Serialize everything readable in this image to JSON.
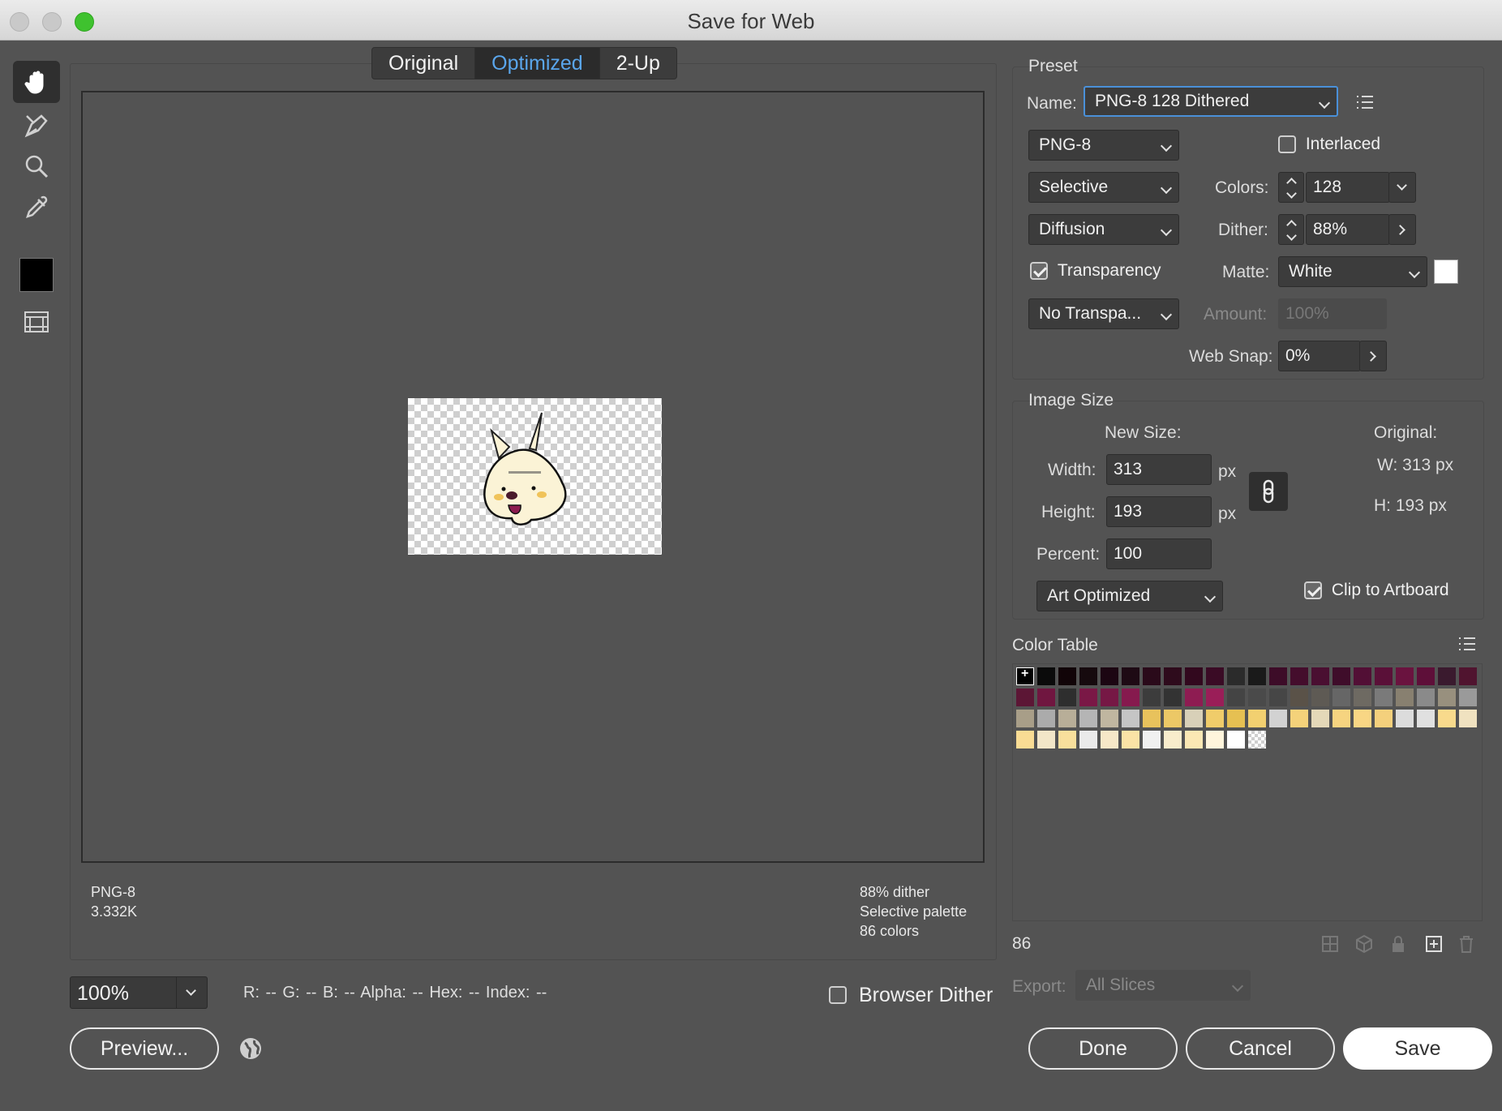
{
  "window": {
    "title": "Save for Web"
  },
  "tabs": [
    {
      "label": "Original",
      "active": false
    },
    {
      "label": "Optimized",
      "active": true
    },
    {
      "label": "2-Up",
      "active": false
    }
  ],
  "tools": [
    "hand-icon",
    "slice-select-icon",
    "zoom-icon",
    "eyedropper-icon",
    "eyedropper-color-swatch",
    "toggle-slices-icon"
  ],
  "preview_info": {
    "format": "PNG-8",
    "size": "3.332K",
    "dither": "88% dither",
    "palette": "Selective palette",
    "colors": "86 colors"
  },
  "bottom": {
    "zoom": "100%",
    "readout": "R: --  G: --  B: --  Alpha: --  Hex: --  Index: --",
    "browser_dither_label": "Browser Dither",
    "browser_dither_checked": false,
    "preview_button": "Preview...",
    "done_button": "Done",
    "cancel_button": "Cancel",
    "save_button": "Save"
  },
  "preset": {
    "group_label": "Preset",
    "name_label": "Name:",
    "name_value": "PNG-8 128 Dithered",
    "format": "PNG-8",
    "interlaced_label": "Interlaced",
    "interlaced_checked": false,
    "reduction": "Selective",
    "colors_label": "Colors:",
    "colors_value": "128",
    "dither_algo": "Diffusion",
    "dither_label": "Dither:",
    "dither_value": "88%",
    "transparency_label": "Transparency",
    "transparency_checked": true,
    "matte_label": "Matte:",
    "matte_value": "White",
    "matte_color": "#ffffff",
    "transparency_dither": "No Transpa...",
    "amount_label": "Amount:",
    "amount_value": "100%",
    "websnap_label": "Web Snap:",
    "websnap_value": "0%"
  },
  "image_size": {
    "group_label": "Image Size",
    "new_size_label": "New Size:",
    "original_label": "Original:",
    "width_label": "Width:",
    "width_value": "313",
    "height_label": "Height:",
    "height_value": "193",
    "percent_label": "Percent:",
    "percent_value": "100",
    "unit": "px",
    "orig_w": "W:  313 px",
    "orig_h": "H:  193 px",
    "quality": "Art Optimized",
    "clip_label": "Clip to Artboard",
    "clip_checked": true
  },
  "color_table": {
    "label": "Color Table",
    "count": "86",
    "export_label": "Export:",
    "export_value": "All Slices",
    "swatches": [
      "#000000",
      "#0b0b0b",
      "#110408",
      "#160a0e",
      "#1c0612",
      "#1e0a14",
      "#2a0a1a",
      "#2e0b1c",
      "#32081e",
      "#3a0b25",
      "#2b2b2b",
      "#1a1a1a",
      "#3d0c28",
      "#440d2c",
      "#4a0f31",
      "#3f0d2a",
      "#520f35",
      "#5a1038",
      "#6a133f",
      "#5e0f39",
      "#3a1a2e",
      "#50142f",
      "#5c1635",
      "#701640",
      "#2e2e2e",
      "#7a1846",
      "#761845",
      "#861a4e",
      "#3c3c3c",
      "#333333",
      "#8e1c52",
      "#9a1e58",
      "#444444",
      "#4a4a4a",
      "#464646",
      "#5a5248",
      "#5e5a54",
      "#666666",
      "#6e6a62",
      "#7a7a7a",
      "#888070",
      "#8a8a8a",
      "#98907e",
      "#9a9a9a",
      "#a89e88",
      "#ababab",
      "#b8ae98",
      "#b5b5b5",
      "#c0b6a0",
      "#c5c5c5",
      "#e8c25c",
      "#ecc866",
      "#d8d0b8",
      "#f0cc6a",
      "#e6c052",
      "#f2d070",
      "#d2d2d2",
      "#f4d27a",
      "#e4d8b8",
      "#f6d480",
      "#f8d684",
      "#f4d07c",
      "#dcdcdc",
      "#e0e0e0",
      "#f8da8c",
      "#f0e2c0",
      "#f9dc94",
      "#f2e6c8",
      "#f8df9c",
      "#eaeaea",
      "#f6e8c8",
      "#fae3a6",
      "#f0f0f0",
      "#f8eccc",
      "#fbe8b4",
      "#fff5dc",
      "#ffffff",
      "#transparent"
    ]
  }
}
